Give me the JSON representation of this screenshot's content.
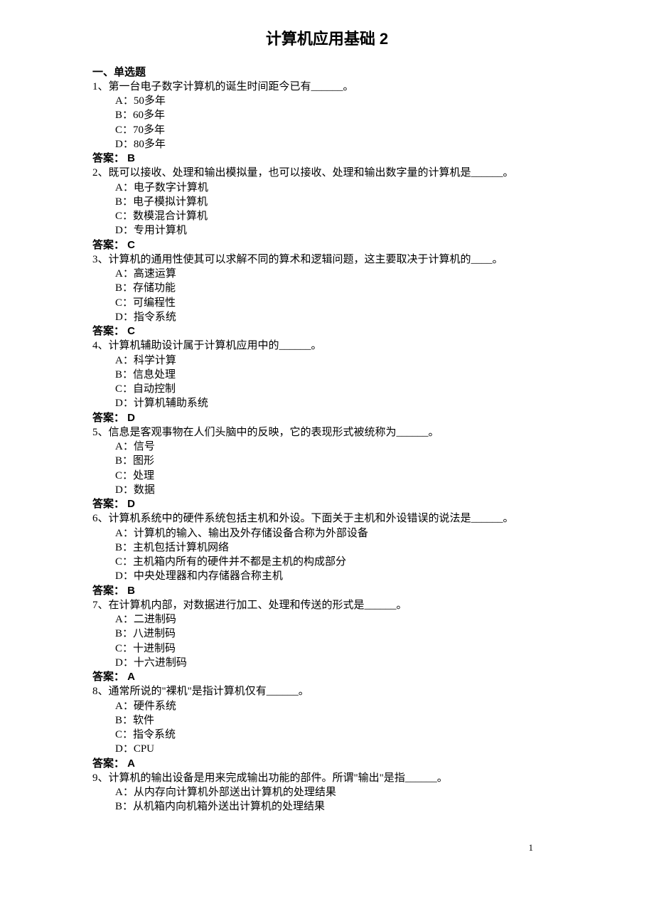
{
  "title": "计算机应用基础 2",
  "section_heading": "一、单选题",
  "answer_label_prefix": "答案：",
  "page_number": "1",
  "questions": [
    {
      "num": "1、",
      "stem": "第一台电子数字计算机的诞生时间距今已有______。",
      "options": [
        "A：50多年",
        "B：60多年",
        "C：70多年",
        "D：80多年"
      ],
      "answer": " B"
    },
    {
      "num": "2、",
      "stem": "既可以接收、处理和输出模拟量，也可以接收、处理和输出数字量的计算机是______。",
      "options": [
        "A：电子数字计算机",
        "B：电子模拟计算机",
        "C：数模混合计算机",
        "D：专用计算机"
      ],
      "answer": " C"
    },
    {
      "num": "3、",
      "stem": "计算机的通用性使其可以求解不同的算术和逻辑问题，这主要取决于计算机的____。",
      "options": [
        "A：高速运算",
        "B：存储功能",
        "C：可编程性",
        "D：指令系统"
      ],
      "answer": " C"
    },
    {
      "num": "4、",
      "stem": "计算机辅助设计属于计算机应用中的______。",
      "options": [
        "A：科学计算",
        "B：信息处理",
        "C：自动控制",
        "D：计算机辅助系统"
      ],
      "answer": " D"
    },
    {
      "num": "5、",
      "stem": "信息是客观事物在人们头脑中的反映，它的表现形式被统称为______。",
      "options": [
        "A：信号",
        "B：图形",
        "C：处理",
        "D：数据"
      ],
      "answer": " D"
    },
    {
      "num": "6、",
      "stem": "计算机系统中的硬件系统包括主机和外设。下面关于主机和外设错误的说法是______。",
      "options": [
        "A：计算机的输入、输出及外存储设备合称为外部设备",
        "B：主机包括计算机网络",
        "C：主机箱内所有的硬件并不都是主机的构成部分",
        "D：中央处理器和内存储器合称主机"
      ],
      "answer": " B"
    },
    {
      "num": "7、",
      "stem": "在计算机内部，对数据进行加工、处理和传送的形式是______。",
      "options": [
        "A：二进制码",
        "B：八进制码",
        "C：十进制码",
        "D：十六进制码"
      ],
      "answer": " A"
    },
    {
      "num": "8、",
      "stem": "通常所说的\"裸机\"是指计算机仅有______。",
      "options": [
        "A：硬件系统",
        "B：软件",
        "C：指令系统",
        "D：CPU"
      ],
      "answer": " A"
    },
    {
      "num": "9、",
      "stem": "计算机的输出设备是用来完成输出功能的部件。所谓\"输出\"是指______。",
      "options": [
        "A：从内存向计算机外部送出计算机的处理结果",
        "B：从机箱内向机箱外送出计算机的处理结果"
      ],
      "answer": null
    }
  ]
}
